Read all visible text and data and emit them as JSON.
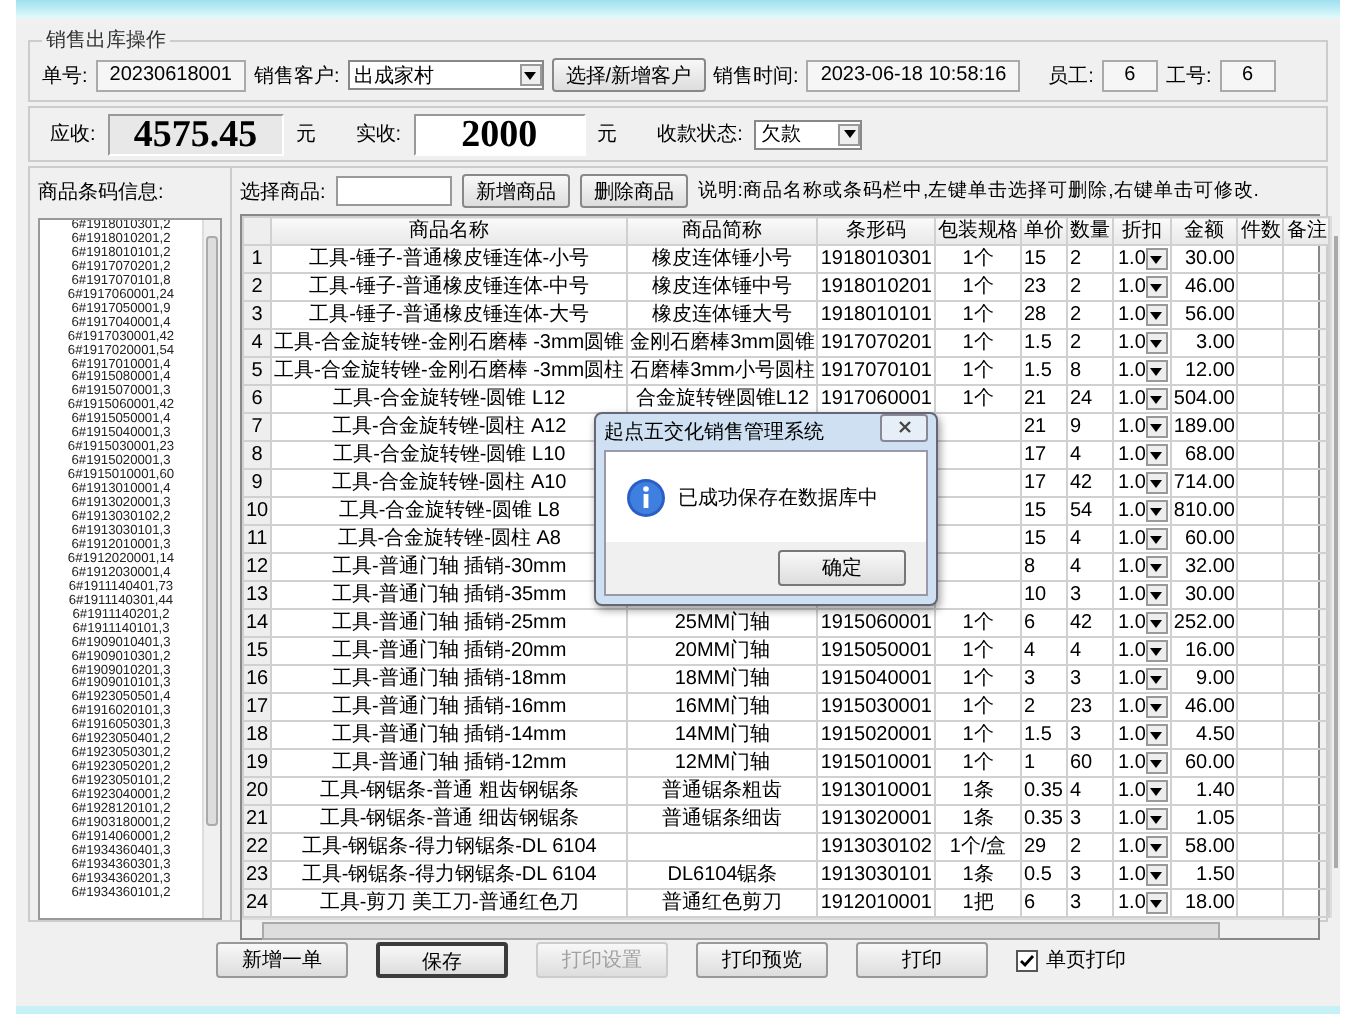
{
  "order_group": {
    "title": "销售出库操作",
    "fields": [
      {
        "kind": "text",
        "label": "单号:",
        "value": "20230618001"
      },
      {
        "kind": "select",
        "label": "销售客户:",
        "value": "出成家村"
      },
      {
        "kind": "button",
        "label": "选择/新增客户"
      },
      {
        "kind": "time",
        "label": "销售时间:",
        "value": "2023-06-18 10:58:16"
      },
      {
        "kind": "short",
        "label": "员工:",
        "value": "6"
      },
      {
        "kind": "short",
        "label": "工号:",
        "value": "6"
      }
    ]
  },
  "payment": {
    "receivable_label": "应收:",
    "receivable": "4575.45",
    "receivable_unit": "元",
    "received_label": "实收:",
    "received": "2000",
    "received_unit": "元",
    "status_label": "收款状态:",
    "status": "欠款"
  },
  "barcode_panel": {
    "title": "商品条码信息:",
    "items": [
      "6#1918010301,2",
      "6#1918010201,2",
      "6#1918010101,2",
      "6#1917070201,2",
      "6#1917070101,8",
      "6#1917060001,24",
      "6#1917050001,9",
      "6#1917040001,4",
      "6#1917030001,42",
      "6#1917020001,54",
      "6#1917010001,4",
      "6#1915080001,4",
      "6#1915070001,3",
      "6#1915060001,42",
      "6#1915050001,4",
      "6#1915040001,3",
      "6#1915030001,23",
      "6#1915020001,3",
      "6#1915010001,60",
      "6#1913010001,4",
      "6#1913020001,3",
      "6#1913030102,2",
      "6#1913030101,3",
      "6#1912010001,3",
      "6#1912020001,14",
      "6#1912030001,4",
      "6#1911140401,73",
      "6#1911140301,44",
      "6#1911140201,2",
      "6#1911140101,3",
      "6#1909010401,3",
      "6#1909010301,2",
      "6#1909010201,3",
      "6#1909010101,3",
      "6#1923050501,4",
      "6#1916020101,3",
      "6#1916050301,3",
      "6#1923050401,2",
      "6#1923050301,2",
      "6#1923050201,2",
      "6#1923050101,2",
      "6#1923040001,2",
      "6#1928120101,2",
      "6#1903180001,2",
      "6#1914060001,2",
      "6#1934360401,3",
      "6#1934360301,3",
      "6#1934360201,3",
      "6#1934360101,2"
    ]
  },
  "product_bar": {
    "label": "选择商品:",
    "buttons": [
      "新增商品",
      "删除商品"
    ],
    "note": "说明:商品名称或条码栏中,左键单击选择可删除,右键单击可修改."
  },
  "table": {
    "columns": [
      "商品名称",
      "商品简称",
      "条形码",
      "包装规格",
      "单价",
      "数量",
      "折扣",
      "金额",
      "件数",
      "备注"
    ],
    "rows": [
      {
        "no": "1",
        "name": "工具-锤子-普通橡皮锤连体-小号",
        "short": "橡皮连体锤小号",
        "barcode": "1918010301",
        "pack": "1个",
        "price": "15",
        "qty": "2",
        "discount": "1.0",
        "amount": "30.00"
      },
      {
        "no": "2",
        "name": "工具-锤子-普通橡皮锤连体-中号",
        "short": "橡皮连体锤中号",
        "barcode": "1918010201",
        "pack": "1个",
        "price": "23",
        "qty": "2",
        "discount": "1.0",
        "amount": "46.00"
      },
      {
        "no": "3",
        "name": "工具-锤子-普通橡皮锤连体-大号",
        "short": "橡皮连体锤大号",
        "barcode": "1918010101",
        "pack": "1个",
        "price": "28",
        "qty": "2",
        "discount": "1.0",
        "amount": "56.00"
      },
      {
        "no": "4",
        "name": "工具-合金旋转锉-金刚石磨棒 -3mm圆锥",
        "short": "金刚石磨棒3mm圆锥",
        "barcode": "1917070201",
        "pack": "1个",
        "price": "1.5",
        "qty": "2",
        "discount": "1.0",
        "amount": "3.00"
      },
      {
        "no": "5",
        "name": "工具-合金旋转锉-金刚石磨棒 -3mm圆柱",
        "short": "石磨棒3mm小号圆柱",
        "barcode": "1917070101",
        "pack": "1个",
        "price": "1.5",
        "qty": "8",
        "discount": "1.0",
        "amount": "12.00"
      },
      {
        "no": "6",
        "name": "工具-合金旋转锉-圆锥 L12",
        "short": "合金旋转锉圆锥L12",
        "barcode": "1917060001",
        "pack": "1个",
        "price": "21",
        "qty": "24",
        "discount": "1.0",
        "amount": "504.00"
      },
      {
        "no": "7",
        "name": "工具-合金旋转锉-圆柱 A12",
        "price": "21",
        "qty": "9",
        "discount": "1.0",
        "amount": "189.00"
      },
      {
        "no": "8",
        "name": "工具-合金旋转锉-圆锥 L10",
        "price": "17",
        "qty": "4",
        "discount": "1.0",
        "amount": "68.00"
      },
      {
        "no": "9",
        "name": "工具-合金旋转锉-圆柱 A10",
        "price": "17",
        "qty": "42",
        "discount": "1.0",
        "amount": "714.00"
      },
      {
        "no": "10",
        "name": "工具-合金旋转锉-圆锥 L8",
        "price": "15",
        "qty": "54",
        "discount": "1.0",
        "amount": "810.00"
      },
      {
        "no": "11",
        "name": "工具-合金旋转锉-圆柱 A8",
        "price": "15",
        "qty": "4",
        "discount": "1.0",
        "amount": "60.00"
      },
      {
        "no": "12",
        "name": "工具-普通门轴 插销-30mm",
        "price": "8",
        "qty": "4",
        "discount": "1.0",
        "amount": "32.00"
      },
      {
        "no": "13",
        "name": "工具-普通门轴 插销-35mm",
        "price": "10",
        "qty": "3",
        "discount": "1.0",
        "amount": "30.00"
      },
      {
        "no": "14",
        "name": "工具-普通门轴 插销-25mm",
        "short": "25MM门轴",
        "barcode": "1915060001",
        "pack": "1个",
        "price": "6",
        "qty": "42",
        "discount": "1.0",
        "amount": "252.00"
      },
      {
        "no": "15",
        "name": "工具-普通门轴 插销-20mm",
        "short": "20MM门轴",
        "barcode": "1915050001",
        "pack": "1个",
        "price": "4",
        "qty": "4",
        "discount": "1.0",
        "amount": "16.00"
      },
      {
        "no": "16",
        "name": "工具-普通门轴 插销-18mm",
        "short": "18MM门轴",
        "barcode": "1915040001",
        "pack": "1个",
        "price": "3",
        "qty": "3",
        "discount": "1.0",
        "amount": "9.00"
      },
      {
        "no": "17",
        "name": "工具-普通门轴 插销-16mm",
        "short": "16MM门轴",
        "barcode": "1915030001",
        "pack": "1个",
        "price": "2",
        "qty": "23",
        "discount": "1.0",
        "amount": "46.00"
      },
      {
        "no": "18",
        "name": "工具-普通门轴 插销-14mm",
        "short": "14MM门轴",
        "barcode": "1915020001",
        "pack": "1个",
        "price": "1.5",
        "qty": "3",
        "discount": "1.0",
        "amount": "4.50"
      },
      {
        "no": "19",
        "name": "工具-普通门轴 插销-12mm",
        "short": "12MM门轴",
        "barcode": "1915010001",
        "pack": "1个",
        "price": "1",
        "qty": "60",
        "discount": "1.0",
        "amount": "60.00"
      },
      {
        "no": "20",
        "name": "工具-钢锯条-普通 粗齿钢锯条",
        "short": "普通锯条粗齿",
        "barcode": "1913010001",
        "pack": "1条",
        "price": "0.35",
        "qty": "4",
        "discount": "1.0",
        "amount": "1.40"
      },
      {
        "no": "21",
        "name": "工具-钢锯条-普通 细齿钢锯条",
        "short": "普通锯条细齿",
        "barcode": "1913020001",
        "pack": "1条",
        "price": "0.35",
        "qty": "3",
        "discount": "1.0",
        "amount": "1.05"
      },
      {
        "no": "22",
        "name": "工具-钢锯条-得力钢锯条-DL 6104",
        "barcode": "1913030102",
        "pack": "1个/盒",
        "price": "29",
        "qty": "2",
        "discount": "1.0",
        "amount": "58.00"
      },
      {
        "no": "23",
        "name": "工具-钢锯条-得力钢锯条-DL 6104",
        "short": "DL6104锯条",
        "barcode": "1913030101",
        "pack": "1条",
        "price": "0.5",
        "qty": "3",
        "discount": "1.0",
        "amount": "1.50"
      },
      {
        "no": "24",
        "name": "工具-剪刀 美工刀-普通红色刀",
        "short": "普通红色剪刀",
        "barcode": "1912010001",
        "pack": "1把",
        "price": "6",
        "qty": "3",
        "discount": "1.0",
        "amount": "18.00"
      }
    ]
  },
  "buttons": [
    {
      "label": "新增一单",
      "disabled": false,
      "focused": false
    },
    {
      "label": "保存",
      "disabled": false,
      "focused": true
    },
    {
      "label": "打印设置",
      "disabled": true,
      "focused": false
    },
    {
      "label": "打印预览",
      "disabled": false,
      "focused": false
    },
    {
      "label": "打印",
      "disabled": false,
      "focused": false
    }
  ],
  "single_page_print": {
    "label": "单页打印",
    "checked": true
  },
  "dialog": {
    "title": "起点五交化销售管理系统",
    "message": "已成功保存在数据库中",
    "button": "确定"
  }
}
